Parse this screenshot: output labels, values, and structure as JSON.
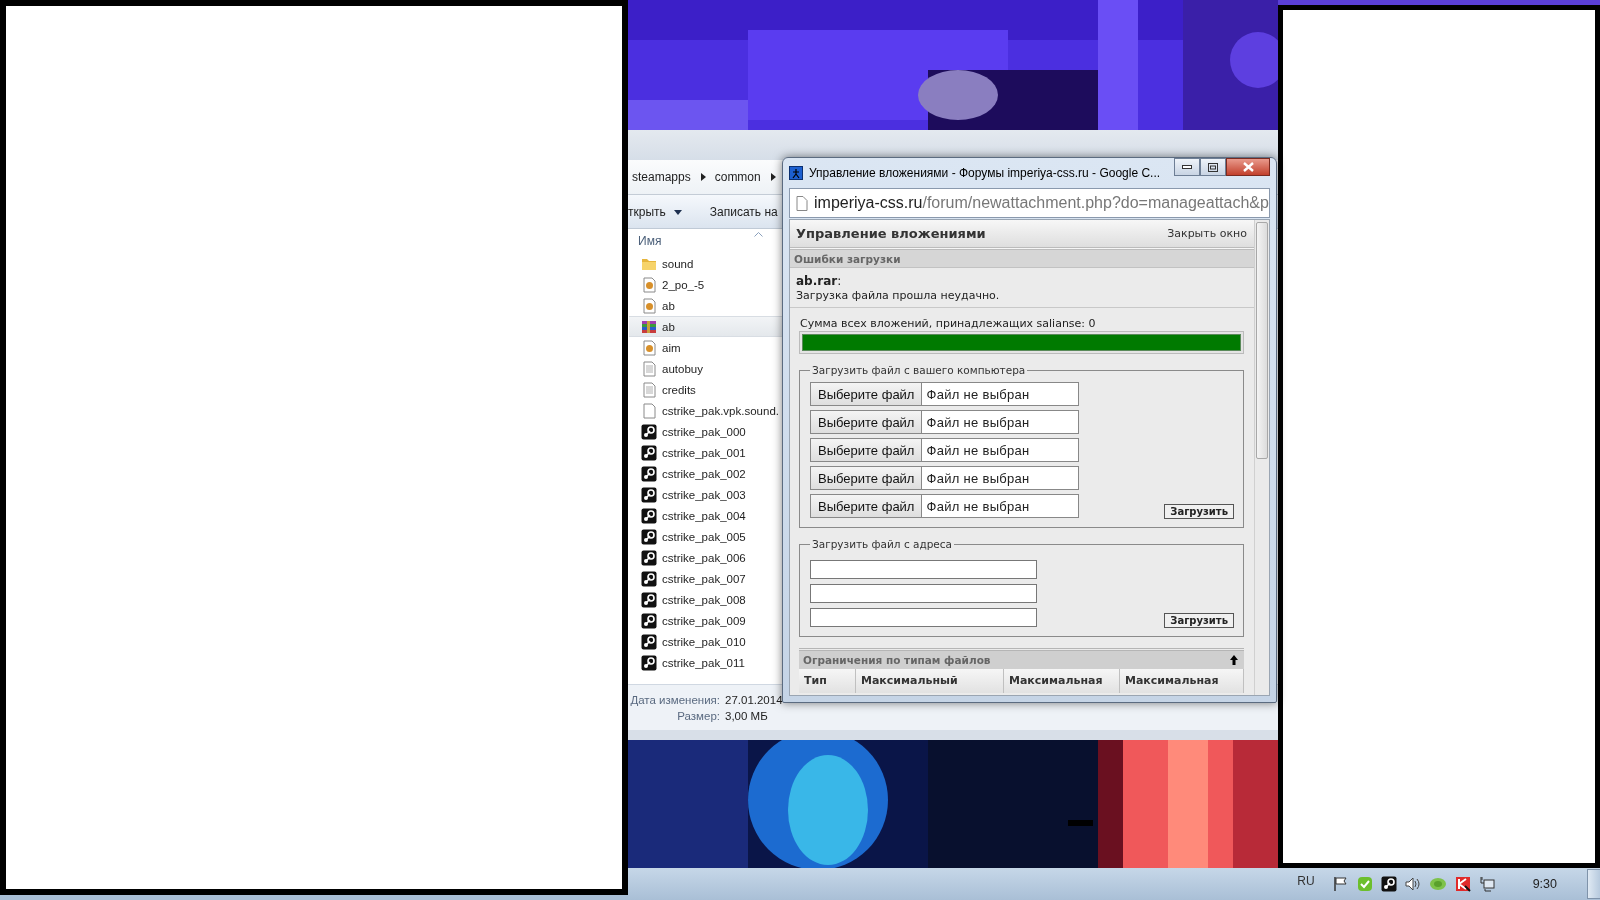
{
  "explorer": {
    "breadcrumb": [
      "steamapps",
      "common"
    ],
    "toolbar": [
      "ткрыть",
      "Записать на"
    ],
    "column": "Имя",
    "files": [
      {
        "name": "sound",
        "kind": "folder",
        "selected": false
      },
      {
        "name": "2_po_-5",
        "kind": "config",
        "selected": false
      },
      {
        "name": "ab",
        "kind": "config",
        "selected": false
      },
      {
        "name": "ab",
        "kind": "archive",
        "selected": true
      },
      {
        "name": "aim",
        "kind": "config",
        "selected": false
      },
      {
        "name": "autobuy",
        "kind": "text",
        "selected": false
      },
      {
        "name": "credits",
        "kind": "text",
        "selected": false
      },
      {
        "name": "cstrike_pak.vpk.sound.",
        "kind": "blank",
        "selected": false
      },
      {
        "name": "cstrike_pak_000",
        "kind": "app",
        "selected": false
      },
      {
        "name": "cstrike_pak_001",
        "kind": "app",
        "selected": false
      },
      {
        "name": "cstrike_pak_002",
        "kind": "app",
        "selected": false
      },
      {
        "name": "cstrike_pak_003",
        "kind": "app",
        "selected": false
      },
      {
        "name": "cstrike_pak_004",
        "kind": "app",
        "selected": false
      },
      {
        "name": "cstrike_pak_005",
        "kind": "app",
        "selected": false
      },
      {
        "name": "cstrike_pak_006",
        "kind": "app",
        "selected": false
      },
      {
        "name": "cstrike_pak_007",
        "kind": "app",
        "selected": false
      },
      {
        "name": "cstrike_pak_008",
        "kind": "app",
        "selected": false
      },
      {
        "name": "cstrike_pak_009",
        "kind": "app",
        "selected": false
      },
      {
        "name": "cstrike_pak_010",
        "kind": "app",
        "selected": false
      },
      {
        "name": "cstrike_pak_011",
        "kind": "app",
        "selected": false
      }
    ],
    "details": [
      {
        "label": "Дата изменения:",
        "value": "27.01.2014"
      },
      {
        "label": "Размер:",
        "value": "3,00 МБ"
      }
    ]
  },
  "popup": {
    "title": "Управление вложениями - Форумы imperiya-css.ru - Google C...",
    "url_host": "imperiya-css.ru",
    "url_path": "/forum/newattachment.php?do=manageattach&p",
    "heading": "Управление вложениями",
    "close_link": "Закрыть окно",
    "errors_title": "Ошибки загрузки",
    "error_file": "**ab.rar**:",
    "error_message": "Загрузка файла прошла неудачно.",
    "quota_label": "Сумма всех вложений, принадлежащих salianse: 0",
    "quota": {
      "level": 1
    },
    "upload_local": {
      "legend": "Загрузить файл с вашего компьютера",
      "inputs": [
        {
          "button": "Выберите файл",
          "status": "Файл не выбран"
        },
        {
          "button": "Выберите файл",
          "status": "Файл не выбран"
        },
        {
          "button": "Выберите файл",
          "status": "Файл не выбран"
        },
        {
          "button": "Выберите файл",
          "status": "Файл не выбран"
        },
        {
          "button": "Выберите файл",
          "status": "Файл не выбран"
        }
      ],
      "submit": "Загрузить"
    },
    "upload_url": {
      "legend": "Загрузить файл с адреса",
      "inputs": [
        {
          "kind": "text"
        },
        {
          "kind": "text"
        },
        {
          "kind": "text"
        }
      ],
      "submit": "Загрузить"
    },
    "limits": {
      "title": "Ограничения по типам файлов",
      "columns": [
        "Тип",
        "Максимальный",
        "Максимальная",
        "Максимальная"
      ]
    }
  },
  "taskbar": {
    "language": "RU",
    "clock": "9:30"
  }
}
